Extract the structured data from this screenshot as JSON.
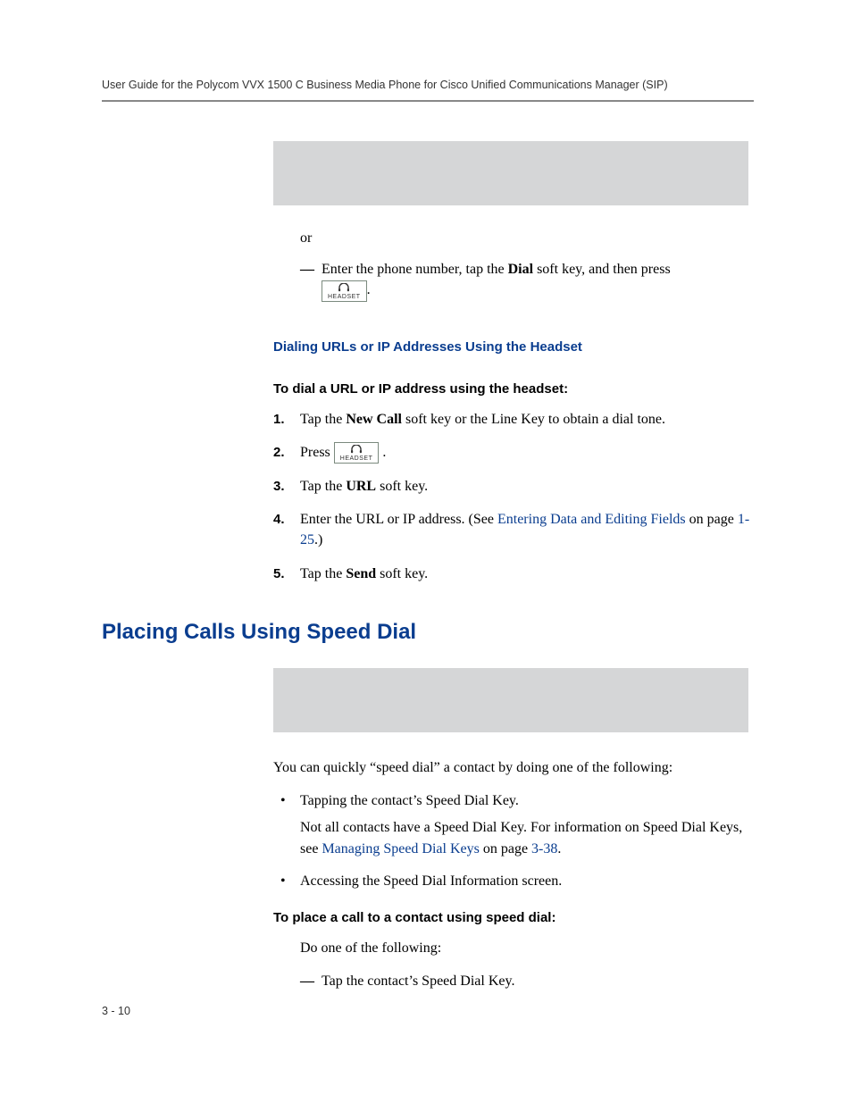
{
  "header": {
    "running_head": "User Guide for the Polycom VVX 1500 C Business Media Phone for Cisco Unified Communications Manager (SIP)"
  },
  "top_continuation": {
    "or": "or",
    "dash_pre": "Enter the phone number, tap the ",
    "dash_bold": "Dial",
    "dash_post": " soft key, and then press ",
    "period": "."
  },
  "headset_btn": {
    "label": "HEADSET"
  },
  "sec_headset_url": {
    "heading": "Dialing URLs or IP Addresses Using the Headset",
    "task": "To dial a URL or IP address using the headset:",
    "step1_a": "Tap the ",
    "step1_b": "New Call",
    "step1_c": " soft key or the Line Key to obtain a dial tone.",
    "step2_a": "Press ",
    "step2_b": " .",
    "step3_a": "Tap the ",
    "step3_b": "URL",
    "step3_c": " soft key.",
    "step4_a": "Enter the URL or IP address. (See ",
    "step4_link": "Entering Data and Editing Fields",
    "step4_b": " on page ",
    "step4_pg": "1-25",
    "step4_c": ".)",
    "step5_a": "Tap the ",
    "step5_b": "Send",
    "step5_c": " soft key."
  },
  "sec_speed_dial": {
    "heading": "Placing Calls Using Speed Dial",
    "intro": "You can quickly “speed dial” a contact by doing one of the following:",
    "b1_line1": "Tapping the contact’s Speed Dial Key.",
    "b1_line2a": "Not all contacts have a Speed Dial Key. For information on Speed Dial Keys, see ",
    "b1_link": "Managing Speed Dial Keys",
    "b1_line2b": " on page ",
    "b1_pg": "3-38",
    "b1_line2c": ".",
    "b2": "Accessing the Speed Dial Information screen.",
    "task": "To place a call to a contact using speed dial:",
    "do_one": "Do one of the following:",
    "dash1": "Tap the contact’s Speed Dial Key."
  },
  "footer": {
    "page": "3 - 10"
  }
}
